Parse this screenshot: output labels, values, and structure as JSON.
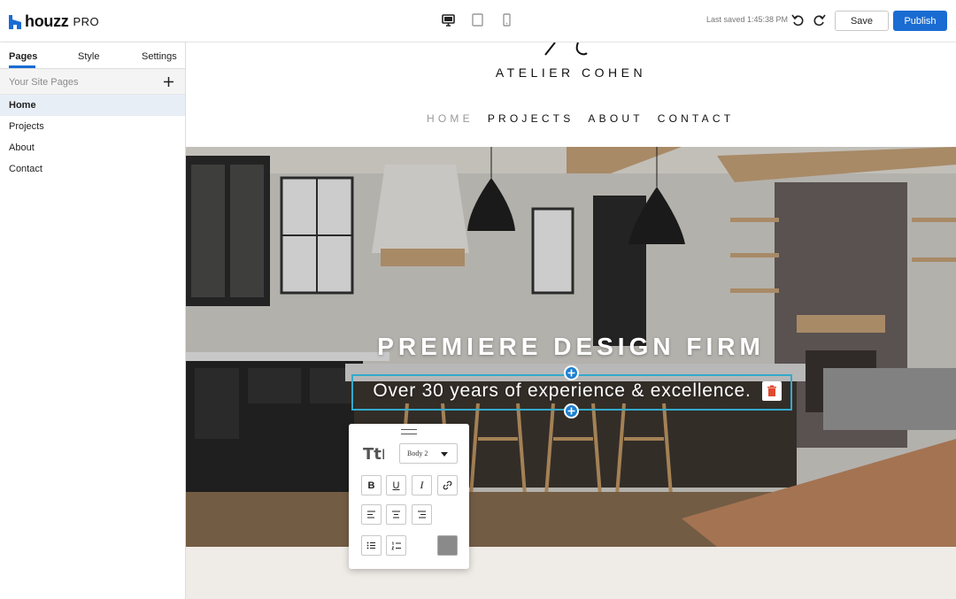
{
  "app": {
    "brand": "houzz",
    "brand_suffix": "PRO",
    "last_saved": "Last saved 1:45:38 PM",
    "save_label": "Save",
    "publish_label": "Publish",
    "accent_color": "#1a6cd3"
  },
  "devices": [
    "desktop-icon",
    "tablet-icon",
    "mobile-icon"
  ],
  "sidebar": {
    "tabs": [
      {
        "label": "Pages",
        "active": true
      },
      {
        "label": "Style",
        "active": false
      },
      {
        "label": "Settings",
        "active": false
      }
    ],
    "section_label": "Your Site Pages",
    "pages": [
      {
        "label": "Home",
        "active": true
      },
      {
        "label": "Projects",
        "active": false
      },
      {
        "label": "About",
        "active": false
      },
      {
        "label": "Contact",
        "active": false
      }
    ]
  },
  "site": {
    "name": "ATELIER COHEN",
    "nav": [
      "HOME",
      "PROJECTS",
      "ABOUT",
      "CONTACT"
    ],
    "hero_title": "PREMIERE DESIGN FIRM",
    "hero_subtitle": "Over 30 years of experience & excellence."
  },
  "text_toolbar": {
    "text_style": "Body 2",
    "text_color": "#8a8a8a",
    "buttons": [
      "bold-icon",
      "underline-icon",
      "italic-icon",
      "link-icon",
      "align-left-icon",
      "align-center-icon",
      "align-right-icon",
      "bullet-list-icon",
      "numbered-list-icon"
    ]
  }
}
